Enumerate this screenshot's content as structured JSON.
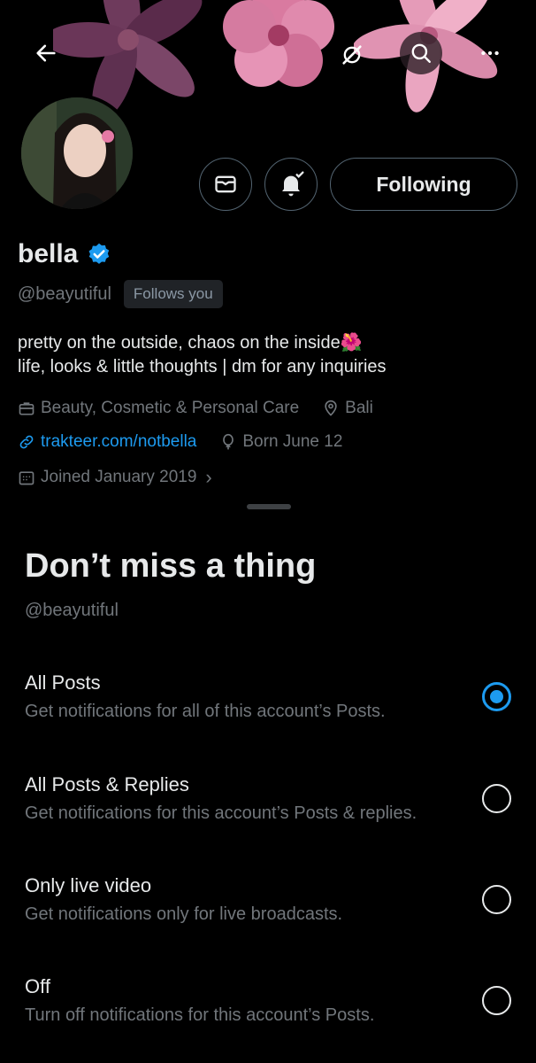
{
  "banner": {
    "back_icon": "arrow-left-icon",
    "translate_icon": "no-sync-icon",
    "search_icon": "search-icon",
    "more_icon": "more-horizontal-icon"
  },
  "profile": {
    "name": "bella",
    "verified": true,
    "handle": "@beayutiful",
    "follows_you": "Follows you",
    "following_label": "Following",
    "bio_line1": "pretty on the outside, chaos on the inside🌺",
    "bio_line2": "life, looks & little thoughts | dm for any inquiries",
    "category": "Beauty, Cosmetic & Personal Care",
    "location": "Bali",
    "website": "trakteer.com/notbella",
    "birthday": "Born June 12",
    "joined": "Joined January 2019",
    "joined_chevron": "›"
  },
  "sheet": {
    "title": "Don’t miss a thing",
    "subtitle": "@beayutiful",
    "options": [
      {
        "label": "All Posts",
        "desc": "Get notifications for all of this account’s Posts.",
        "selected": true
      },
      {
        "label": "All Posts & Replies",
        "desc": "Get notifications for this account’s Posts & replies.",
        "selected": false
      },
      {
        "label": "Only live video",
        "desc": "Get notifications only for live broadcasts.",
        "selected": false
      },
      {
        "label": "Off",
        "desc": "Turn off notifications for this account’s Posts.",
        "selected": false
      }
    ]
  },
  "colors": {
    "accent": "#1d9bf0",
    "background": "#000000",
    "text_primary": "#e7e9ea",
    "text_secondary": "#71767b"
  }
}
